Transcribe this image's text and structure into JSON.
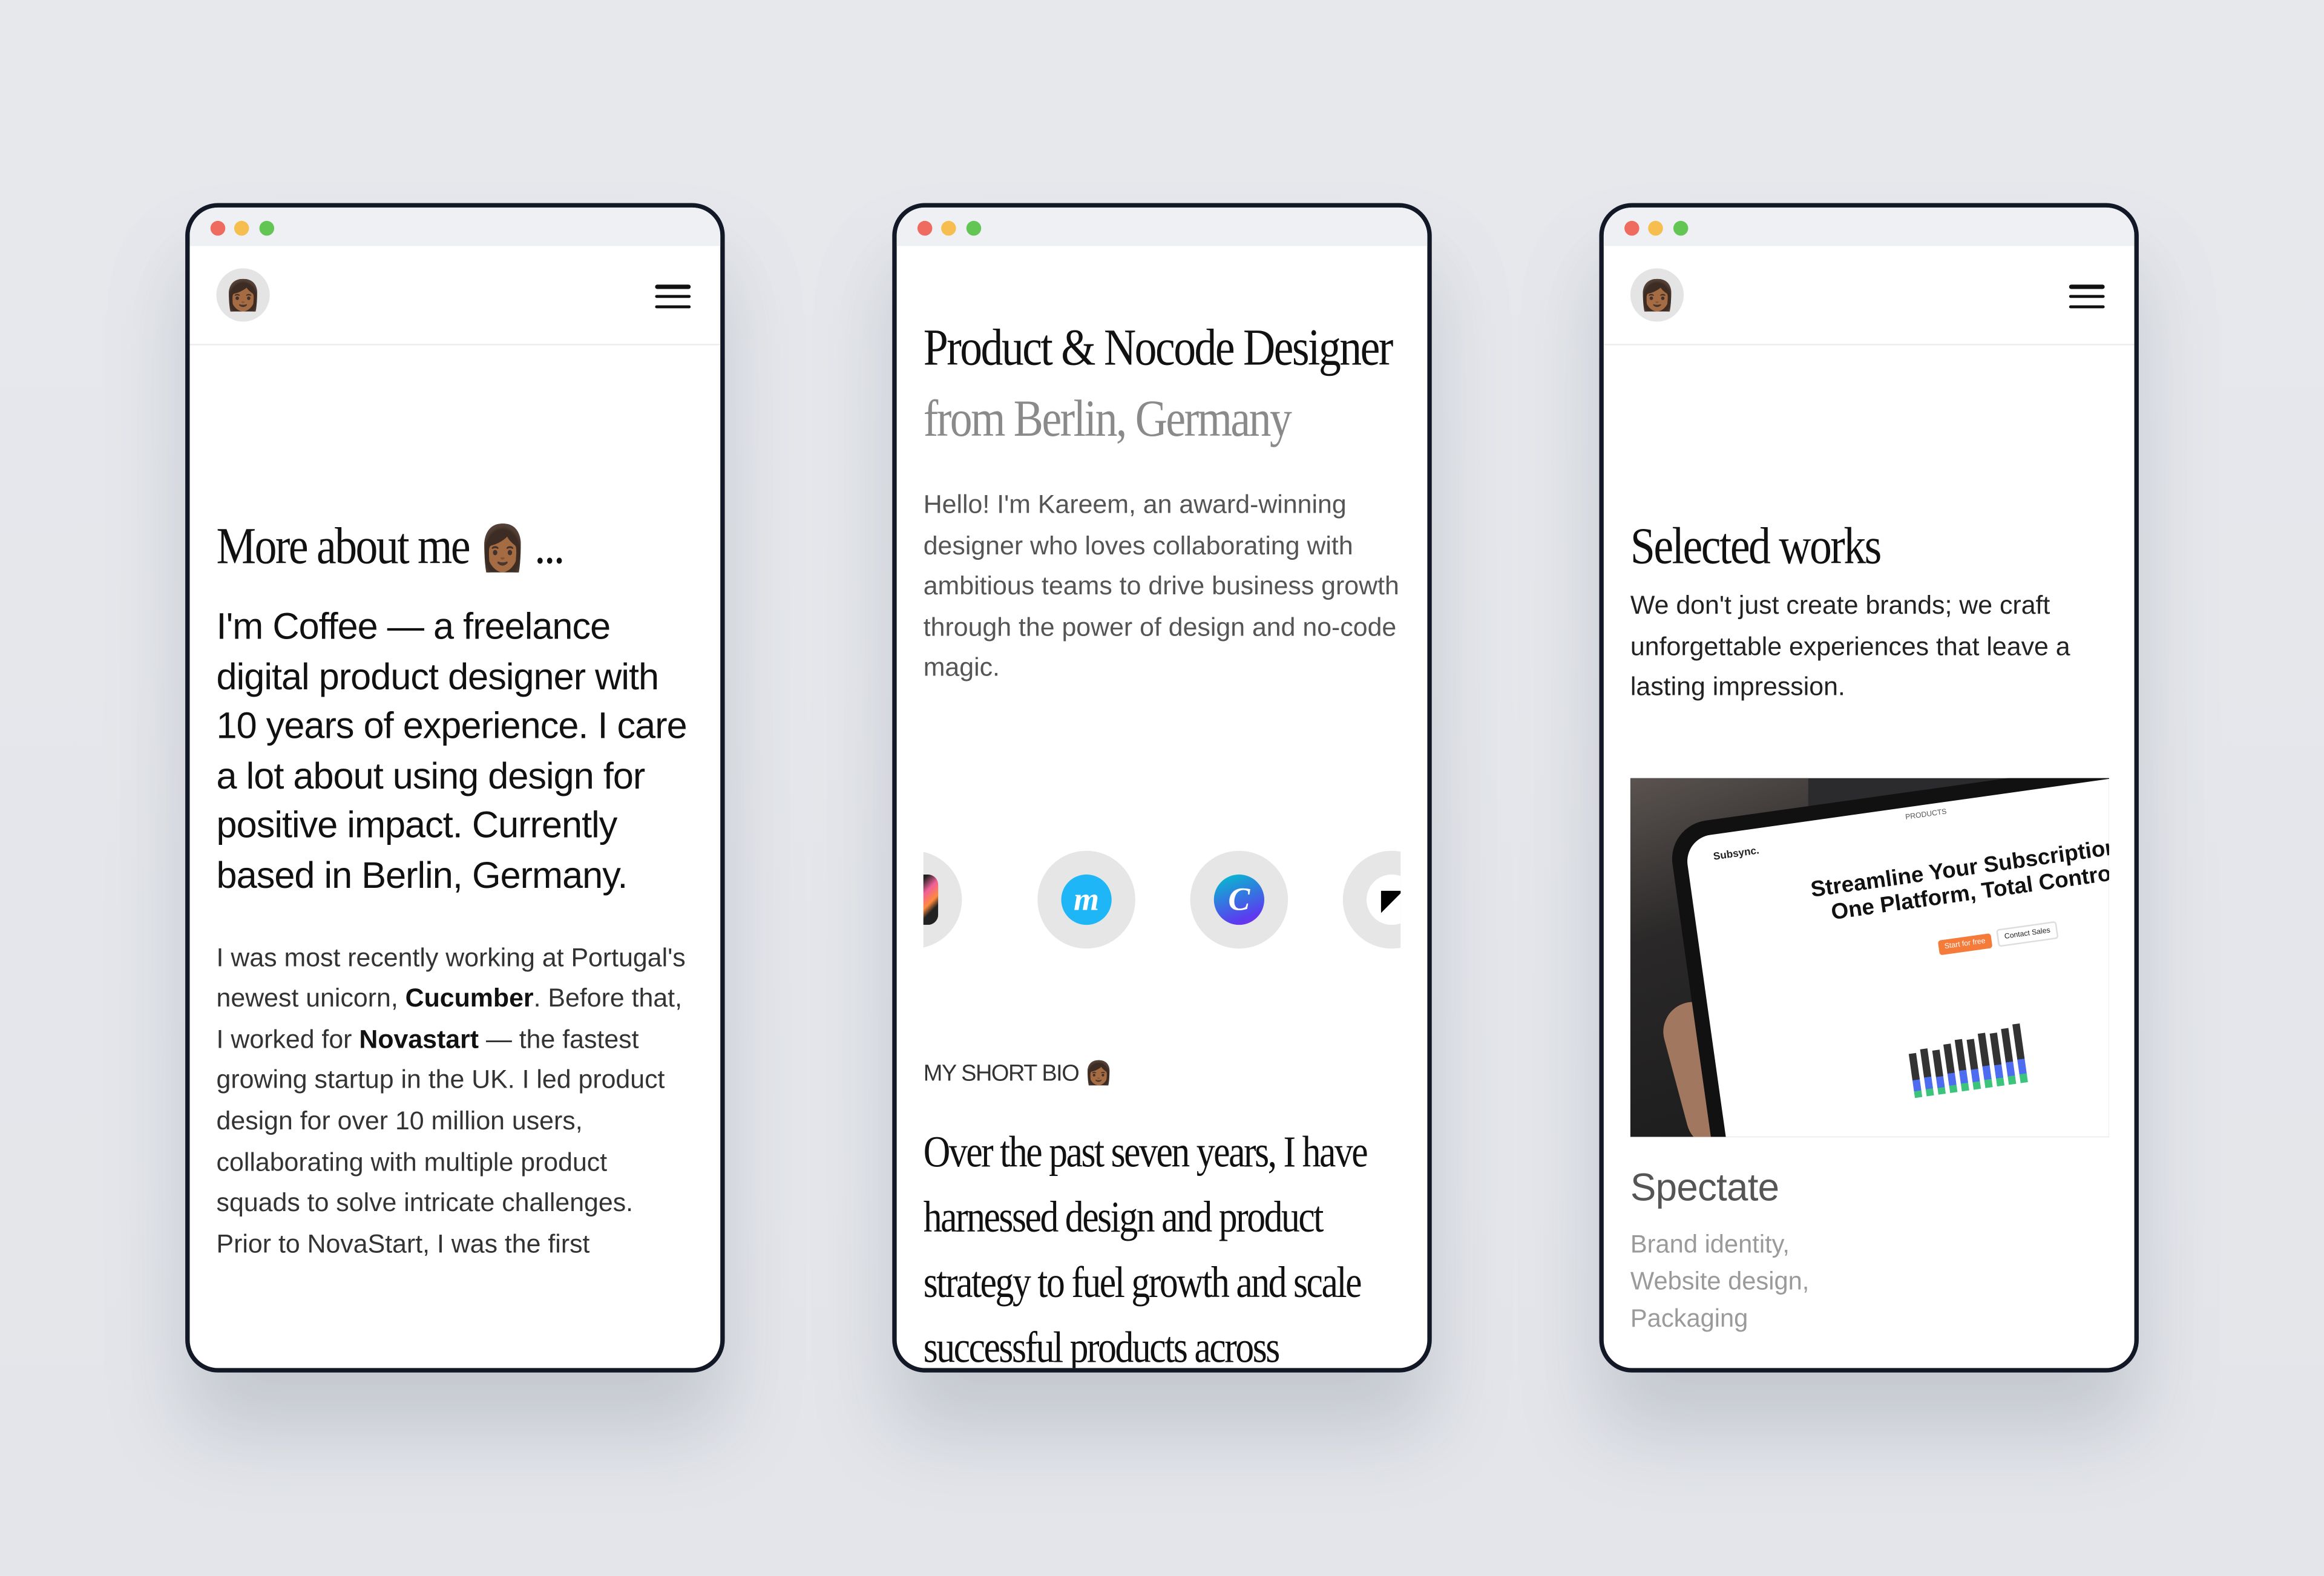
{
  "window_controls": [
    "close",
    "minimize",
    "maximize"
  ],
  "colors": {
    "frame_border": "#121826",
    "close": "#ef6a5f",
    "minimize": "#f6be4f",
    "maximize": "#62c554",
    "background": "#e6e8ec"
  },
  "screen1": {
    "heading": "More about me",
    "heading_suffix": "...",
    "heading_emoji": "👩🏾",
    "lead": "I'm Coffee — a freelance digital product designer with 10 years of experience. I care a lot about using design for positive impact. Currently based in Berlin, Germany.",
    "body": {
      "p1": "I was most recently working at Portugal's newest unicorn, ",
      "b1": "Cucumber",
      "p2": ". Before that, I worked for ",
      "b2": "Novastart",
      "p3": " — the fastest growing startup in the UK. I led product design for over 10 million users, collaborating with multiple product squads to solve intricate challenges.",
      "p4": "Prior to NovaStart, I was the first"
    }
  },
  "screen2": {
    "heading_a": "Product & Nocode Designer",
    "heading_b": "from Berlin, Germany",
    "intro": "Hello! I'm Kareem, an award-winning designer who loves collaborating with ambitious teams to drive business growth through the power of design and no-code magic.",
    "tools": [
      {
        "name": "procreate-icon",
        "color": "#222222"
      },
      {
        "name": "make-icon",
        "letter": "m",
        "color": "#1eb6f7"
      },
      {
        "name": "canva-icon",
        "letter": "C",
        "color": "#5b3cf0"
      },
      {
        "name": "framer-icon",
        "color": "#000000"
      }
    ],
    "bio_label": "MY SHORT BIO",
    "bio_emoji": "👩🏾",
    "bio": "Over the past seven years, I have harnessed design and product strategy to fuel growth and scale successful products across"
  },
  "screen3": {
    "heading": "Selected works",
    "intro": "We don't just create brands; we craft unforgettable experiences that leave a lasting impression.",
    "project": {
      "title": "Spectate",
      "tags": [
        "Brand identity,",
        "Website design,",
        "Packaging"
      ],
      "preview": {
        "brand": "Subsync.",
        "nav": "PRODUCTS",
        "headline_1": "Streamline Your Subscriptions",
        "headline_2": "One Platform, Total Control",
        "cta_primary": "Start for free",
        "cta_secondary": "Contact Sales",
        "accent": "#f47b3a"
      }
    }
  }
}
